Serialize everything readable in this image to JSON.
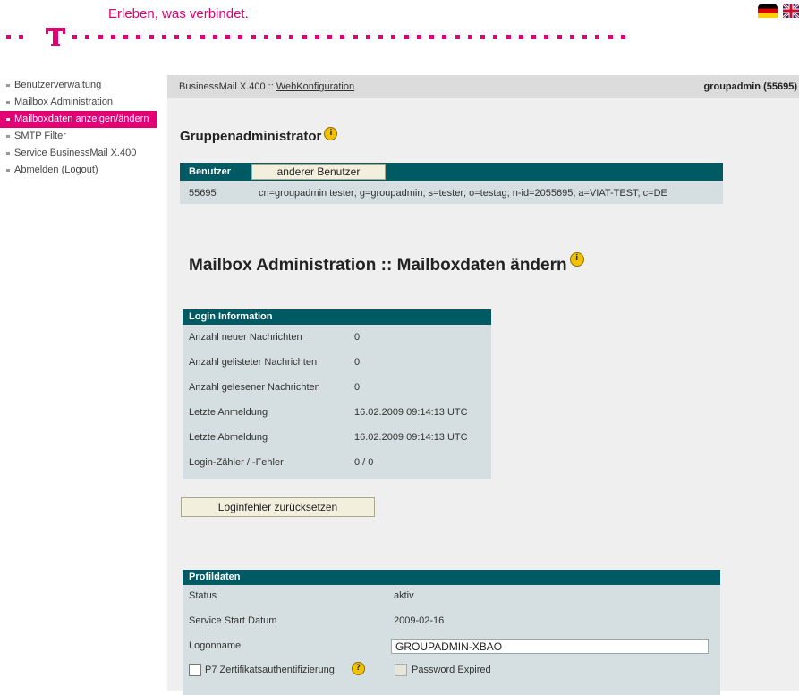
{
  "header": {
    "tagline": "Erleben, was verbindet.",
    "brand_color": "#e20074",
    "flags": [
      "flag-de-icon",
      "flag-uk-icon"
    ]
  },
  "sidebar": {
    "items": [
      {
        "label": "Benutzerverwaltung"
      },
      {
        "label": "Mailbox Administration"
      },
      {
        "label": "Mailboxdaten anzeigen/ändern",
        "active": true
      },
      {
        "label": "SMTP Filter"
      },
      {
        "label": "Service BusinessMail X.400"
      },
      {
        "label": "Abmelden (Logout)"
      }
    ]
  },
  "topbar": {
    "crumb_prefix": "BusinessMail X.400 ::",
    "crumb_link": "WebKonfiguration",
    "user": "groupadmin (55695)"
  },
  "gruppe": {
    "title": "Gruppenadministrator",
    "benutzer_label": "Benutzer",
    "anderer_button": "anderer Benutzer",
    "id": "55695",
    "dn": "cn=groupadmin tester; g=groupadmin; s=tester; o=testag; n-id=2055695; a=VIAT-TEST; c=DE"
  },
  "page_title": "Mailbox Administration :: Mailboxdaten ändern",
  "login_info": {
    "title": "Login Information",
    "rows": [
      {
        "label": "Anzahl neuer Nachrichten",
        "value": "0"
      },
      {
        "label": "Anzahl gelisteter Nachrichten",
        "value": "0"
      },
      {
        "label": "Anzahl gelesener Nachrichten",
        "value": "0"
      },
      {
        "label": "Letzte Anmeldung",
        "value": "16.02.2009 09:14:13 UTC"
      },
      {
        "label": "Letzte Abmeldung",
        "value": "16.02.2009 09:14:13 UTC"
      },
      {
        "label": "Login-Zähler / -Fehler",
        "value": "0 / 0"
      }
    ],
    "reset_button": "Loginfehler zurücksetzen"
  },
  "profil": {
    "title": "Profildaten",
    "status_label": "Status",
    "status_value": "aktiv",
    "start_label": "Service Start Datum",
    "start_value": "2009-02-16",
    "logon_label": "Logonname",
    "logon_value": "GROUPADMIN-XBAO",
    "p7_label": "P7 Zertifikatsauthentifizierung",
    "pw_expired_label": "Password Expired"
  }
}
